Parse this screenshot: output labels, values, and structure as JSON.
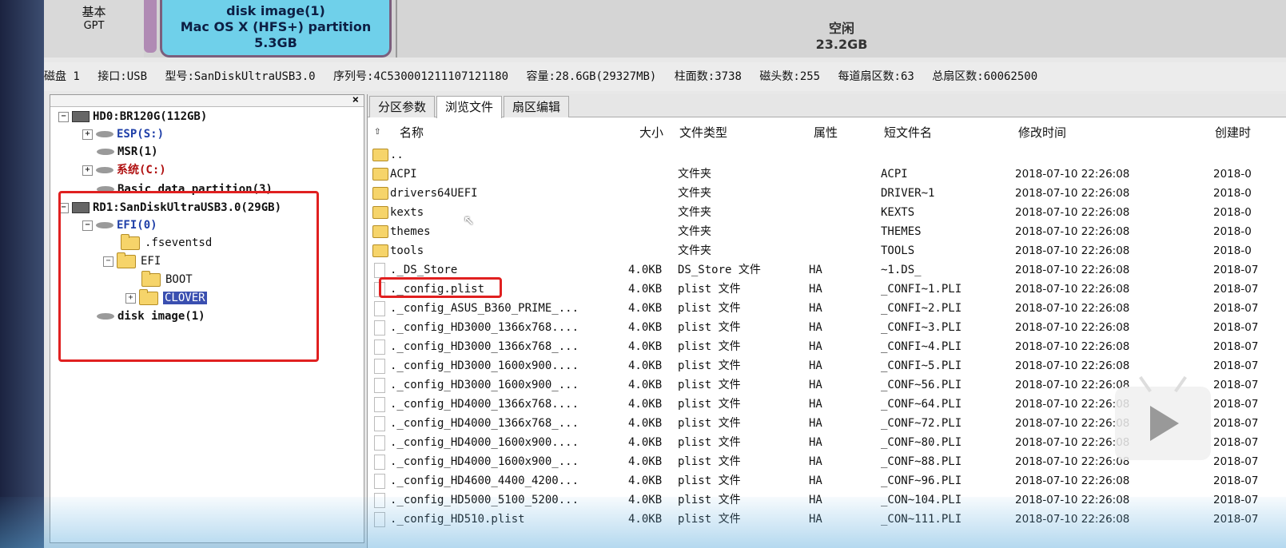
{
  "diskmap": {
    "basic_label": "基本",
    "basic_sub": "GPT",
    "image_line1": "disk image(1)",
    "image_line2": "Mac OS X (HFS+) partition",
    "image_line3": "5.3GB",
    "free_label": "空闲",
    "free_size": "23.2GB"
  },
  "info": {
    "disk": "磁盘 1",
    "iface": "接口:USB",
    "model": "型号:SanDiskUltraUSB3.0",
    "serial": "序列号:4C530001211107121180",
    "capacity": "容量:28.6GB(29327MB)",
    "cylinders": "柱面数:3738",
    "heads": "磁头数:255",
    "sectors_per_track": "每道扇区数:63",
    "total_sectors": "总扇区数:60062500"
  },
  "tree": {
    "close": "×",
    "hd0": "HD0:BR120G(112GB)",
    "esp": "ESP(S:)",
    "msr": "MSR(1)",
    "sys": "系统(C:)",
    "basic": "Basic data partition(3)",
    "rd1": "RD1:SanDiskUltraUSB3.0(29GB)",
    "efi_part": "EFI(0)",
    "fseventsd": ".fseventsd",
    "efi_dir": "EFI",
    "boot": "BOOT",
    "clover": "CLOVER",
    "disk_image": "disk image(1)"
  },
  "tabs": [
    "分区参数",
    "浏览文件",
    "扇区编辑"
  ],
  "columns": {
    "name": "名称",
    "size": "大小",
    "type": "文件类型",
    "attr": "属性",
    "short": "短文件名",
    "mod": "修改时间",
    "cre": "创建时"
  },
  "parent_dir": "..",
  "rows": [
    {
      "name": "ACPI",
      "size": "",
      "type": "文件夹",
      "attr": "",
      "short": "ACPI",
      "mod": "2018-07-10 22:26:08",
      "cre": "2018-0",
      "folder": true
    },
    {
      "name": "drivers64UEFI",
      "size": "",
      "type": "文件夹",
      "attr": "",
      "short": "DRIVER~1",
      "mod": "2018-07-10 22:26:08",
      "cre": "2018-0",
      "folder": true
    },
    {
      "name": "kexts",
      "size": "",
      "type": "文件夹",
      "attr": "",
      "short": "KEXTS",
      "mod": "2018-07-10 22:26:08",
      "cre": "2018-0",
      "folder": true
    },
    {
      "name": "themes",
      "size": "",
      "type": "文件夹",
      "attr": "",
      "short": "THEMES",
      "mod": "2018-07-10 22:26:08",
      "cre": "2018-0",
      "folder": true
    },
    {
      "name": "tools",
      "size": "",
      "type": "文件夹",
      "attr": "",
      "short": "TOOLS",
      "mod": "2018-07-10 22:26:08",
      "cre": "2018-0",
      "folder": true
    },
    {
      "name": "._DS_Store",
      "size": "4.0KB",
      "type": "DS_Store 文件",
      "attr": "HA",
      "short": "~1.DS_",
      "mod": "2018-07-10 22:26:08",
      "cre": "2018-07",
      "folder": false
    },
    {
      "name": "._config.plist",
      "size": "4.0KB",
      "type": "plist 文件",
      "attr": "HA",
      "short": "_CONFI~1.PLI",
      "mod": "2018-07-10 22:26:08",
      "cre": "2018-07",
      "folder": false
    },
    {
      "name": "._config_ASUS_B360_PRIME_...",
      "size": "4.0KB",
      "type": "plist 文件",
      "attr": "HA",
      "short": "_CONFI~2.PLI",
      "mod": "2018-07-10 22:26:08",
      "cre": "2018-07",
      "folder": false
    },
    {
      "name": "._config_HD3000_1366x768....",
      "size": "4.0KB",
      "type": "plist 文件",
      "attr": "HA",
      "short": "_CONFI~3.PLI",
      "mod": "2018-07-10 22:26:08",
      "cre": "2018-07",
      "folder": false
    },
    {
      "name": "._config_HD3000_1366x768_...",
      "size": "4.0KB",
      "type": "plist 文件",
      "attr": "HA",
      "short": "_CONFI~4.PLI",
      "mod": "2018-07-10 22:26:08",
      "cre": "2018-07",
      "folder": false
    },
    {
      "name": "._config_HD3000_1600x900....",
      "size": "4.0KB",
      "type": "plist 文件",
      "attr": "HA",
      "short": "_CONFI~5.PLI",
      "mod": "2018-07-10 22:26:08",
      "cre": "2018-07",
      "folder": false
    },
    {
      "name": "._config_HD3000_1600x900_...",
      "size": "4.0KB",
      "type": "plist 文件",
      "attr": "HA",
      "short": "_CONF~56.PLI",
      "mod": "2018-07-10 22:26:08",
      "cre": "2018-07",
      "folder": false
    },
    {
      "name": "._config_HD4000_1366x768....",
      "size": "4.0KB",
      "type": "plist 文件",
      "attr": "HA",
      "short": "_CONF~64.PLI",
      "mod": "2018-07-10 22:26:08",
      "cre": "2018-07",
      "folder": false
    },
    {
      "name": "._config_HD4000_1366x768_...",
      "size": "4.0KB",
      "type": "plist 文件",
      "attr": "HA",
      "short": "_CONF~72.PLI",
      "mod": "2018-07-10 22:26:08",
      "cre": "2018-07",
      "folder": false
    },
    {
      "name": "._config_HD4000_1600x900....",
      "size": "4.0KB",
      "type": "plist 文件",
      "attr": "HA",
      "short": "_CONF~80.PLI",
      "mod": "2018-07-10 22:26:08",
      "cre": "2018-07",
      "folder": false
    },
    {
      "name": "._config_HD4000_1600x900_...",
      "size": "4.0KB",
      "type": "plist 文件",
      "attr": "HA",
      "short": "_CONF~88.PLI",
      "mod": "2018-07-10 22:26:08",
      "cre": "2018-07",
      "folder": false
    },
    {
      "name": "._config_HD4600_4400_4200...",
      "size": "4.0KB",
      "type": "plist 文件",
      "attr": "HA",
      "short": "_CONF~96.PLI",
      "mod": "2018-07-10 22:26:08",
      "cre": "2018-07",
      "folder": false
    },
    {
      "name": "._config_HD5000_5100_5200...",
      "size": "4.0KB",
      "type": "plist 文件",
      "attr": "HA",
      "short": "_CON~104.PLI",
      "mod": "2018-07-10 22:26:08",
      "cre": "2018-07",
      "folder": false
    },
    {
      "name": "._config_HD510.plist",
      "size": "4.0KB",
      "type": "plist 文件",
      "attr": "HA",
      "short": "_CON~111.PLI",
      "mod": "2018-07-10 22:26:08",
      "cre": "2018-07",
      "folder": false
    }
  ]
}
